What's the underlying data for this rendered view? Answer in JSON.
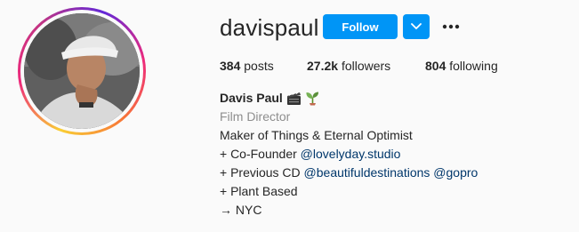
{
  "profile": {
    "username": "davispaul",
    "follow_label": "Follow",
    "stats": {
      "posts_count": "384",
      "posts_label": "posts",
      "followers_count": "27.2k",
      "followers_label": "followers",
      "following_count": "804",
      "following_label": "following"
    },
    "bio": {
      "full_name": "Davis Paul",
      "name_emojis": [
        "clapper-board-emoji",
        "seedling-emoji"
      ],
      "category": "Film Director",
      "line1": "Maker of Things & Eternal Optimist",
      "line2_prefix": "+ Co-Founder ",
      "line2_link": "@lovelyday.studio",
      "line3_prefix": "+ Previous CD ",
      "line3_link1": "@beautifuldestinations",
      "line3_link2": "@gopro",
      "line4": "+ Plant Based",
      "line5": "→ NYC"
    }
  },
  "colors": {
    "accent_blue": "#0095f6",
    "link_blue": "#00376b",
    "secondary_text": "#8e8e8e",
    "background": "#fafafa"
  }
}
